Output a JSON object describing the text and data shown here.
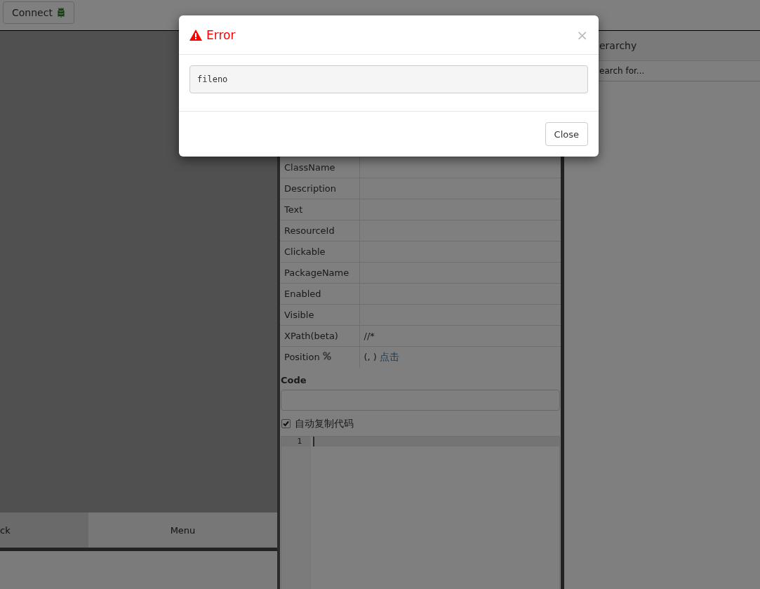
{
  "toolbar": {
    "connect_button": "Connect"
  },
  "device_panel": {
    "nav_buttons": [
      {
        "label": "ck",
        "selected": true
      },
      {
        "label": "Menu",
        "selected": false
      }
    ]
  },
  "properties": {
    "rows": [
      {
        "label": "ClassName",
        "value": ""
      },
      {
        "label": "Description",
        "value": ""
      },
      {
        "label": "Text",
        "value": ""
      },
      {
        "label": "ResourceId",
        "value": ""
      },
      {
        "label": "Clickable",
        "value": ""
      },
      {
        "label": "PackageName",
        "value": ""
      },
      {
        "label": "Enabled",
        "value": ""
      },
      {
        "label": "Visible",
        "value": ""
      },
      {
        "label": "XPath(beta)",
        "value": "//*"
      },
      {
        "label": "Position",
        "kind": "position",
        "value": "(, )",
        "link": "点击"
      }
    ],
    "code_label": "Code",
    "auto_copy": {
      "label": "自动复制代码",
      "checked": true
    },
    "editor": {
      "line_numbers": [
        "1"
      ]
    }
  },
  "hierarchy": {
    "title": "erarchy",
    "search_placeholder": "earch for..."
  },
  "modal": {
    "title": "Error",
    "close_symbol": "×",
    "message": "fileno",
    "button": "Close"
  }
}
